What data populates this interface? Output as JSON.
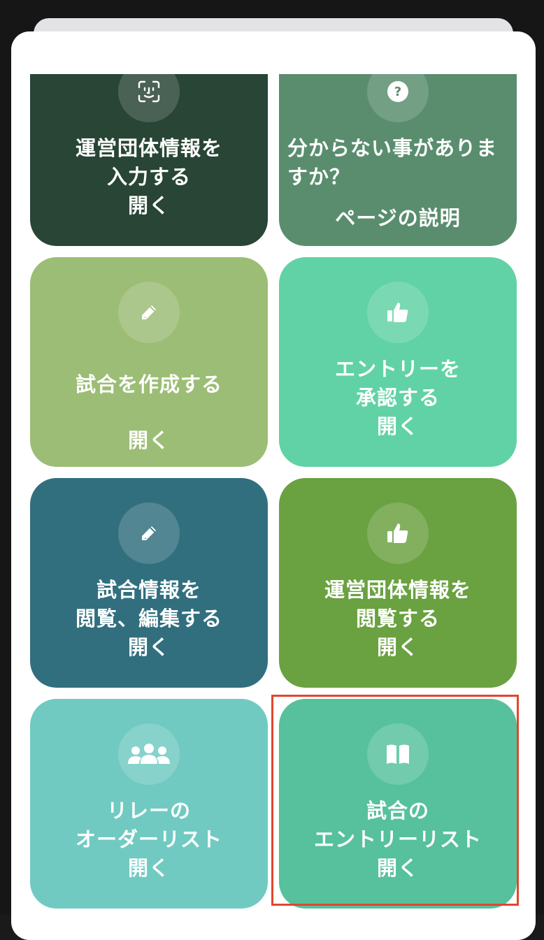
{
  "tiles": [
    {
      "id": "enter-org-info",
      "title_lines": [
        "運営団体情報を",
        "入力する"
      ],
      "action": "開く",
      "icon": "face-scan-icon",
      "color": "#284535"
    },
    {
      "id": "help",
      "title_lines": [
        "分からない事がありま",
        "すか？"
      ],
      "action": "ページの説明",
      "icon": "question-icon",
      "color": "#598d6e"
    },
    {
      "id": "create-match",
      "title_lines": [
        "試合を作成する"
      ],
      "action": "開く",
      "icon": "pencil-icon",
      "color": "#9cbd75"
    },
    {
      "id": "approve-entries",
      "title_lines": [
        "エントリーを",
        "承認する"
      ],
      "action": "開く",
      "icon": "thumbs-up-icon",
      "color": "#61d2a5"
    },
    {
      "id": "match-info",
      "title_lines": [
        "試合情報を",
        "閲覧、編集する"
      ],
      "action": "開く",
      "icon": "pencil-icon",
      "color": "#316f7e"
    },
    {
      "id": "view-org-info",
      "title_lines": [
        "運営団体情報を",
        "閲覧する"
      ],
      "action": "開く",
      "icon": "thumbs-up-icon",
      "color": "#6aa141"
    },
    {
      "id": "relay-order",
      "title_lines": [
        "リレーの",
        "オーダーリスト"
      ],
      "action": "開く",
      "icon": "users-icon",
      "color": "#71cac2"
    },
    {
      "id": "entry-list",
      "title_lines": [
        "試合の",
        "エントリーリスト"
      ],
      "action": "開く",
      "icon": "book-icon",
      "color": "#56c19c"
    }
  ],
  "highlight_color": "#e0472e"
}
